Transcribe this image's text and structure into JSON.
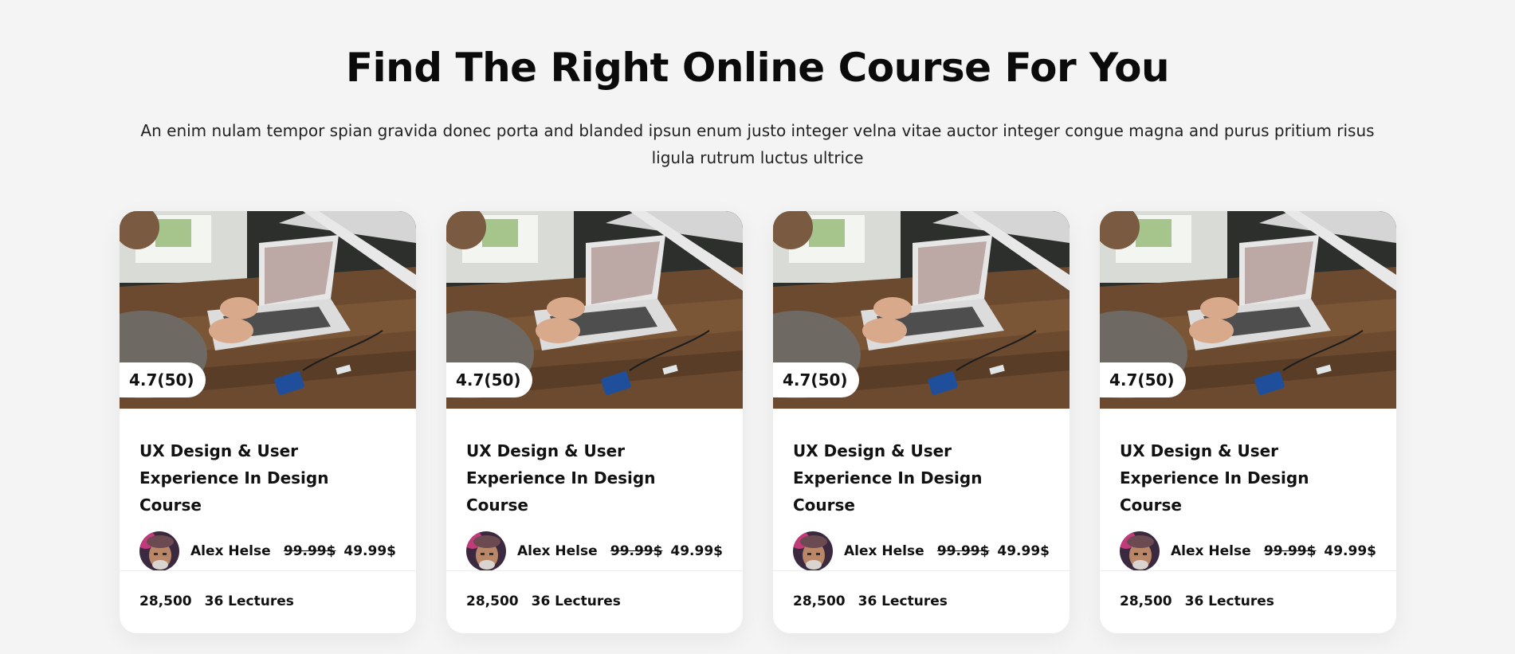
{
  "heading": "Find The Right Online Course For You",
  "subheading": "An enim nulam tempor spian gravida donec porta and blanded ipsun enum justo integer velna vitae auctor integer congue magna and purus pritium risus ligula rutrum luctus ultrice",
  "cards": [
    {
      "rating": "4.7(50)",
      "title": "UX Design & User Experience In Design Course",
      "author": "Alex Helse",
      "old_price": "99.99$",
      "price": "49.99$",
      "students": "28,500",
      "lectures": "36 Lectures",
      "image_icon": "laptop-photo",
      "avatar_icon": "author-avatar"
    },
    {
      "rating": "4.7(50)",
      "title": "UX Design & User Experience In Design Course",
      "author": "Alex Helse",
      "old_price": "99.99$",
      "price": "49.99$",
      "students": "28,500",
      "lectures": "36 Lectures",
      "image_icon": "laptop-photo",
      "avatar_icon": "author-avatar"
    },
    {
      "rating": "4.7(50)",
      "title": "UX Design & User Experience In Design Course",
      "author": "Alex Helse",
      "old_price": "99.99$",
      "price": "49.99$",
      "students": "28,500",
      "lectures": "36 Lectures",
      "image_icon": "laptop-photo",
      "avatar_icon": "author-avatar"
    },
    {
      "rating": "4.7(50)",
      "title": "UX Design & User Experience In Design Course",
      "author": "Alex Helse",
      "old_price": "99.99$",
      "price": "49.99$",
      "students": "28,500",
      "lectures": "36 Lectures",
      "image_icon": "laptop-photo",
      "avatar_icon": "author-avatar"
    }
  ],
  "colors": {
    "background": "#f4f4f4",
    "card": "#ffffff",
    "text": "#111111"
  }
}
